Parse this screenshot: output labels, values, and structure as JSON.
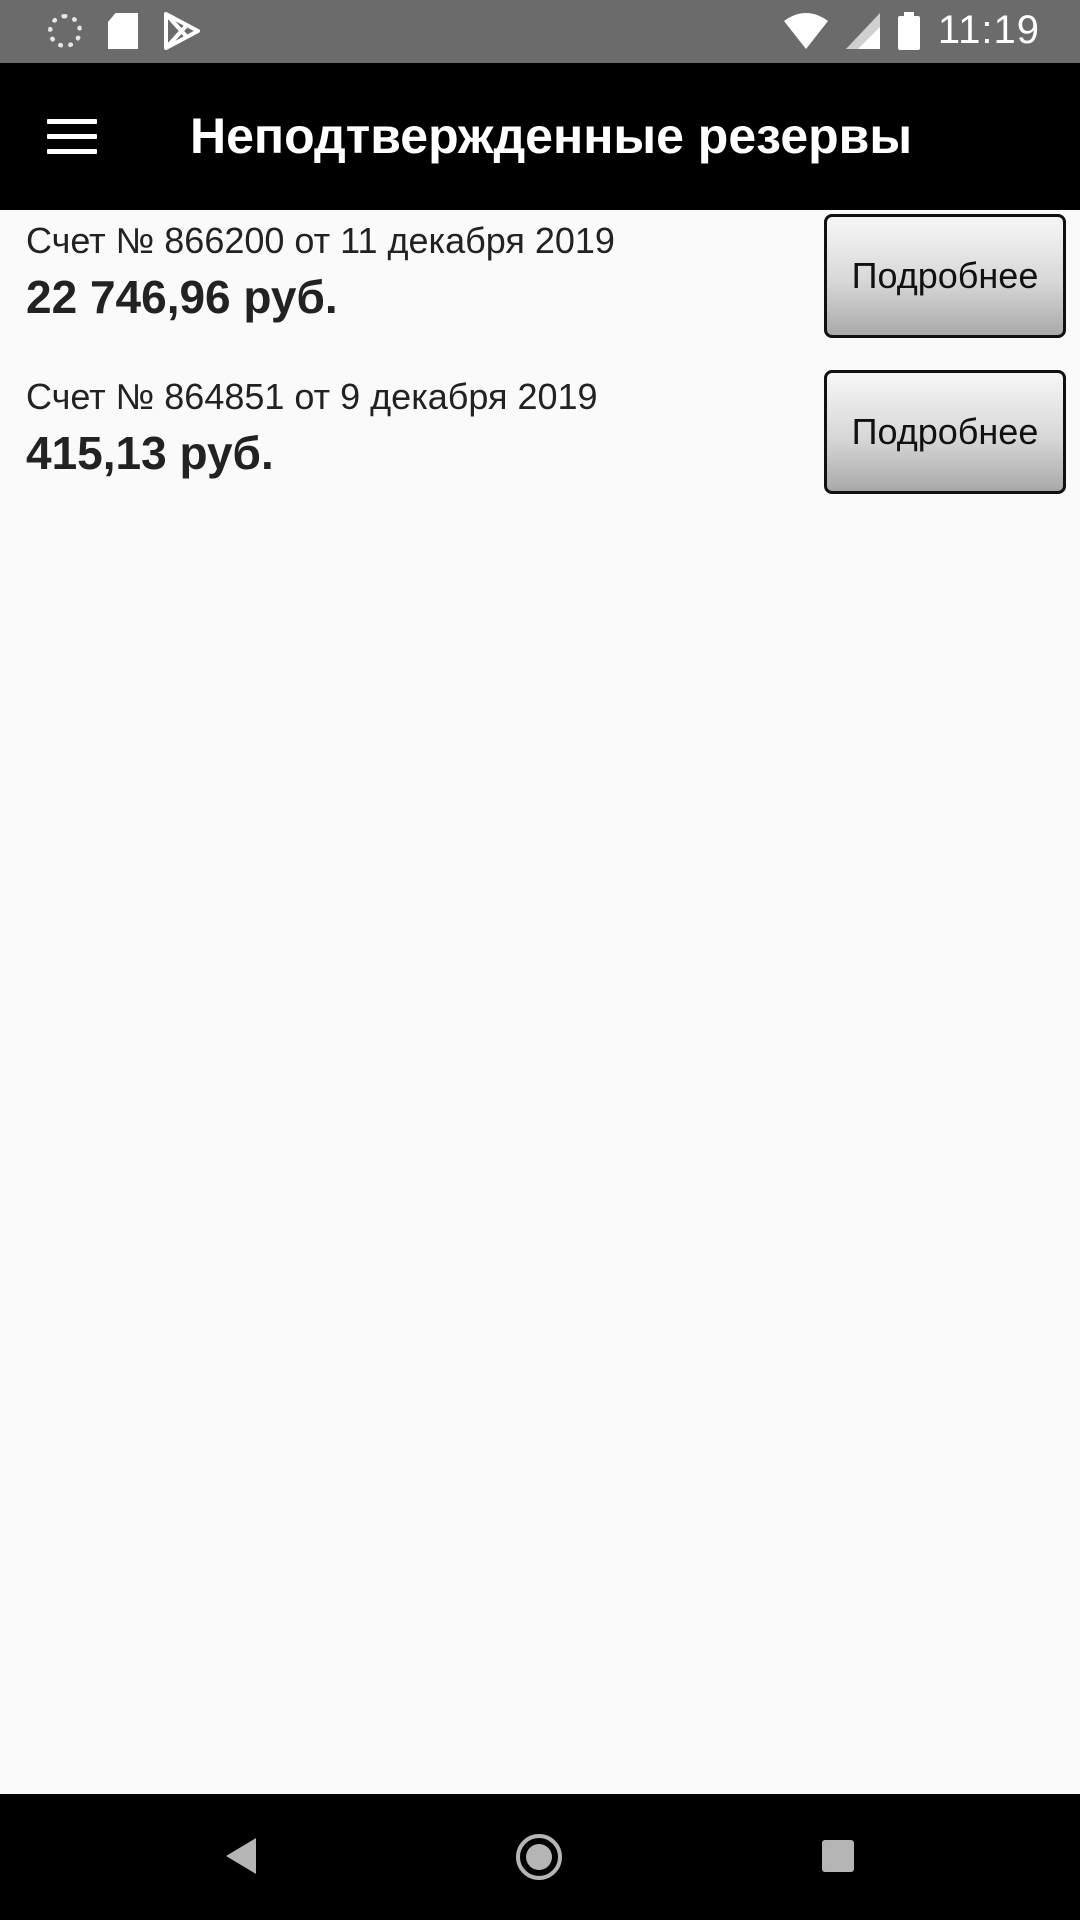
{
  "status_bar": {
    "time": "11:19",
    "left_icons": [
      "spinner-icon",
      "sd-card-icon",
      "play-store-icon"
    ],
    "right_icons": [
      "wifi-icon",
      "signal-icon",
      "battery-icon"
    ]
  },
  "app_bar": {
    "menu_icon": "hamburger-menu-icon",
    "title": "Неподтвержденные резервы"
  },
  "invoices": [
    {
      "title": "Счет № 866200 от 11 декабря 2019",
      "amount": "22 746,96 руб.",
      "button_label": "Подробнее"
    },
    {
      "title": "Счет № 864851 от 9 декабря 2019",
      "amount": "415,13 руб.",
      "button_label": "Подробнее"
    }
  ],
  "nav_bar": {
    "icons": [
      "back-icon",
      "home-icon",
      "recents-icon"
    ]
  },
  "colors": {
    "status_bar": "#6b6b6b",
    "app_bar": "#000000",
    "background": "#fafafa",
    "text": "#222222"
  }
}
